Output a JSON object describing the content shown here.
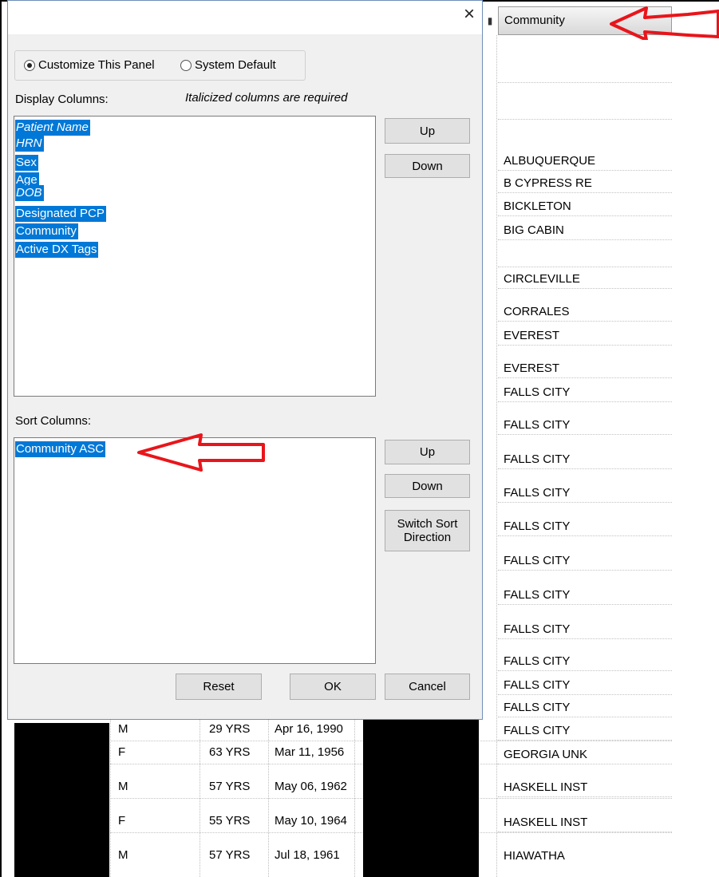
{
  "grid": {
    "column_header": "Community",
    "community_cells": [
      "ALBUQUERQUE",
      "B CYPRESS RE",
      "BICKLETON",
      "BIG CABIN",
      "CIRCLEVILLE",
      "CORRALES",
      "EVEREST",
      "EVEREST",
      "FALLS CITY",
      "FALLS CITY",
      "FALLS CITY",
      "FALLS CITY",
      "FALLS CITY",
      "FALLS CITY",
      "FALLS CITY",
      "FALLS CITY",
      "FALLS CITY",
      "FALLS CITY",
      "FALLS CITY",
      "FALLS CITY",
      "GEORGIA UNK",
      "HASKELL INST",
      "HASKELL INST",
      "HIAWATHA"
    ],
    "rows": [
      {
        "sex": "M",
        "age": "29 YRS",
        "dob": "Apr 16, 1990"
      },
      {
        "sex": "F",
        "age": "63 YRS",
        "dob": "Mar 11, 1956"
      },
      {
        "sex": "M",
        "age": "57 YRS",
        "dob": "May 06, 1962"
      },
      {
        "sex": "F",
        "age": "55 YRS",
        "dob": "May 10, 1964"
      },
      {
        "sex": "M",
        "age": "57 YRS",
        "dob": "Jul 18, 1961"
      }
    ]
  },
  "dialog": {
    "close_glyph": "×",
    "radio_customize": "Customize This Panel",
    "radio_system": "System Default",
    "display_columns_label": "Display Columns:",
    "required_note": "Italicized columns are required",
    "display_columns": [
      {
        "label": "Patient Name",
        "required": true
      },
      {
        "label": "HRN",
        "required": true
      },
      {
        "label": "Sex",
        "required": false
      },
      {
        "label": "Age",
        "required": false
      },
      {
        "label": "DOB",
        "required": true
      },
      {
        "label": "Designated PCP",
        "required": false
      },
      {
        "label": "Community",
        "required": false
      },
      {
        "label": "Active DX Tags",
        "required": false
      }
    ],
    "up_label": "Up",
    "down_label": "Down",
    "sort_columns_label": "Sort Columns:",
    "sort_columns": [
      "Community ASC"
    ],
    "sort_up_label": "Up",
    "sort_down_label": "Down",
    "switch_sort_line1": "Switch Sort",
    "switch_sort_line2": "Direction",
    "reset_label": "Reset",
    "ok_label": "OK",
    "cancel_label": "Cancel"
  },
  "colors": {
    "selection": "#0078d7",
    "annotation_arrow": "#e8151b"
  }
}
